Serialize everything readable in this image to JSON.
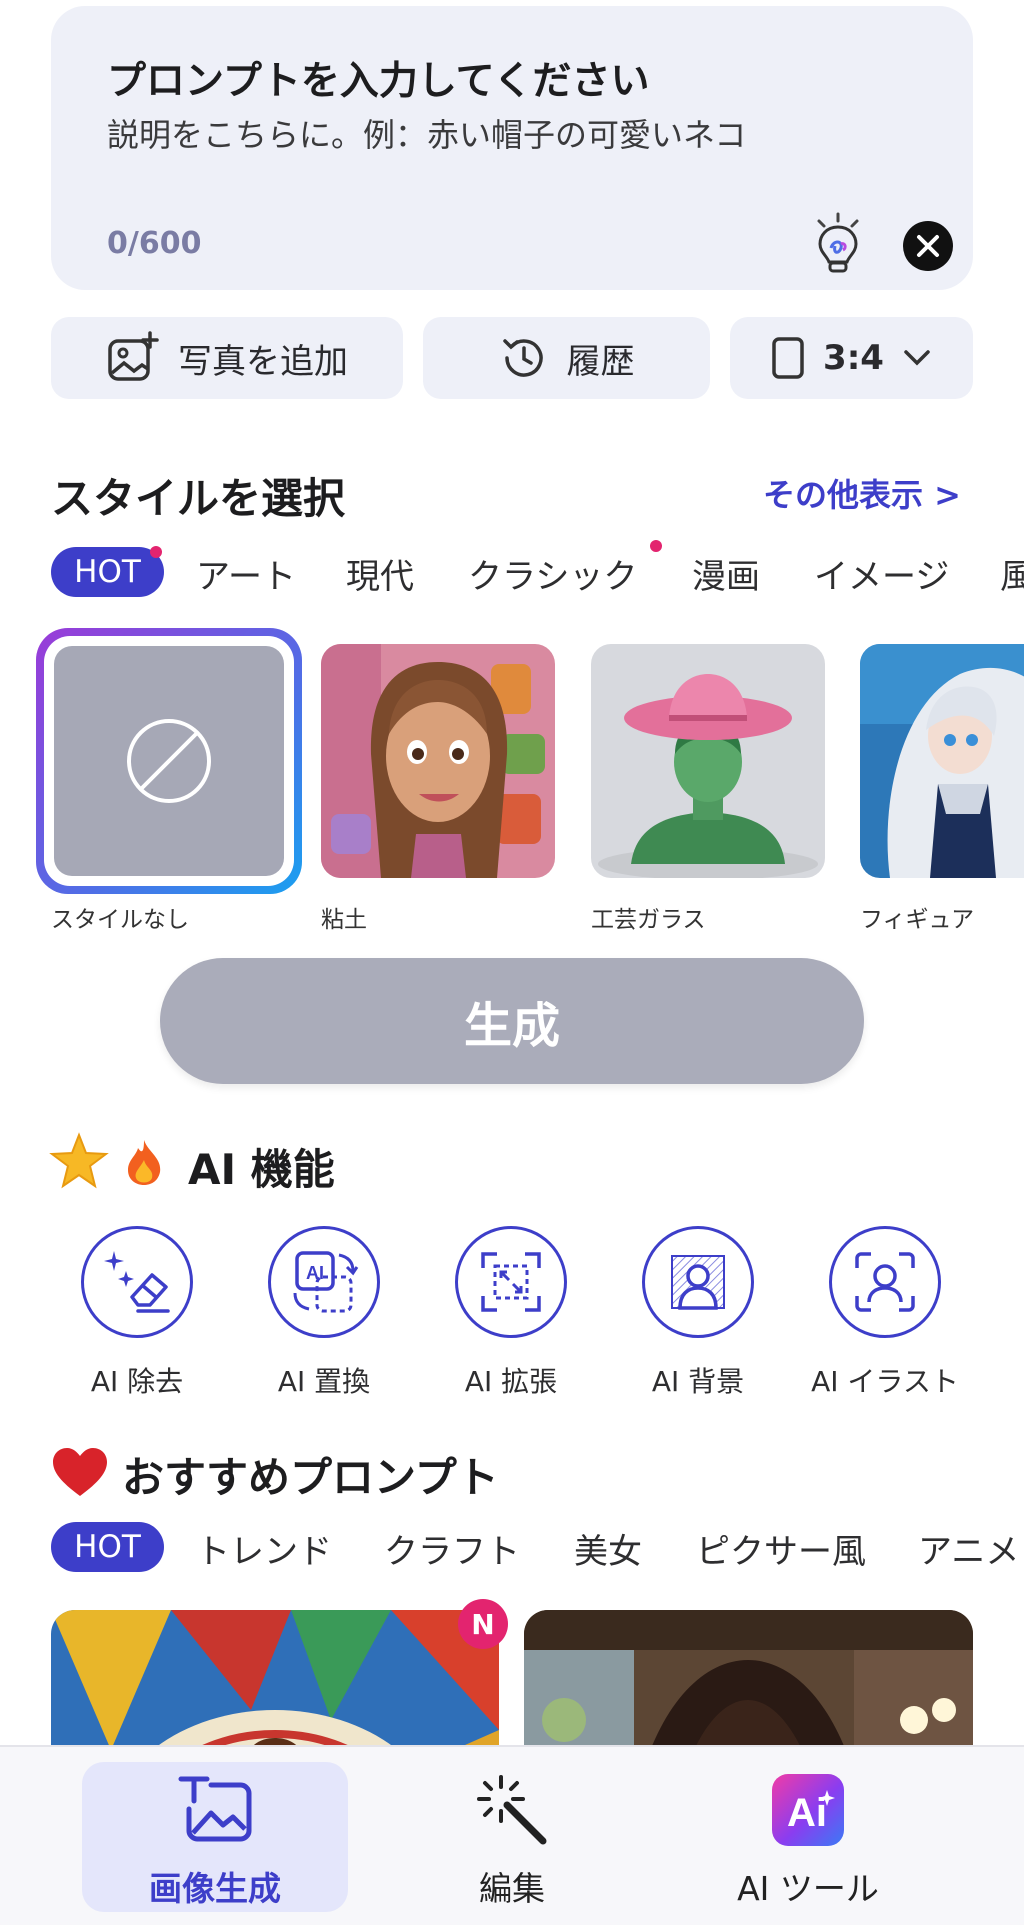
{
  "prompt": {
    "title": "プロンプトを入力してください",
    "placeholder": "説明をこちらに。例：赤い帽子の可愛いネコ",
    "counter": "0/600",
    "hint_icon": "lightbulb-icon",
    "clear_icon": "close-icon"
  },
  "toolbar": {
    "add_photo_label": "写真を追加",
    "history_label": "履歴",
    "ratio_label": "3:4"
  },
  "style_section": {
    "title": "スタイルを選択",
    "more_link": "その他表示 >",
    "tabs": [
      "HOT",
      "アート",
      "現代",
      "クラシック",
      "漫画",
      "イメージ",
      "風"
    ],
    "styles": [
      {
        "label": "スタイルなし",
        "selected": true
      },
      {
        "label": "粘土",
        "selected": false
      },
      {
        "label": "工芸ガラス",
        "selected": false
      },
      {
        "label": "フィギュア",
        "selected": false
      }
    ]
  },
  "generate_button": "生成",
  "ai_section": {
    "title": "AI 機能",
    "features": [
      {
        "label": "AI 除去",
        "icon": "eraser-sparkle-icon"
      },
      {
        "label": "AI 置換",
        "icon": "ai-swap-icon"
      },
      {
        "label": "AI 拡張",
        "icon": "expand-icon"
      },
      {
        "label": "AI 背景",
        "icon": "background-person-icon"
      },
      {
        "label": "AI イラスト",
        "icon": "face-scan-icon"
      }
    ]
  },
  "recommend_section": {
    "title": "おすすめプロンプト",
    "tabs": [
      "HOT",
      "トレンド",
      "クラフト",
      "美女",
      "ピクサー風",
      "アニメ"
    ],
    "new_badge": "N"
  },
  "bottom_nav": {
    "items": [
      {
        "label": "画像生成",
        "icon": "image-generate-icon",
        "active": true
      },
      {
        "label": "編集",
        "icon": "magic-wand-icon",
        "active": false
      },
      {
        "label": "AI ツール",
        "icon": "ai-tools-icon",
        "active": false
      }
    ]
  },
  "colors": {
    "accent": "#3d3ec9",
    "badge_pink": "#e3246f",
    "panel_bg": "#eef0f8",
    "disabled_button": "#aaacba"
  }
}
